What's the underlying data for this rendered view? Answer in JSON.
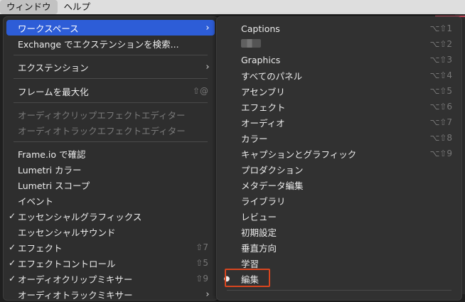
{
  "menubar": {
    "items": [
      {
        "label": "ウィンドウ",
        "active": true
      },
      {
        "label": "ヘルプ",
        "active": false
      }
    ]
  },
  "main_menu": {
    "items": [
      {
        "label": "ワークスペース",
        "checked": false,
        "shortcut": "",
        "submenu": true,
        "disabled": false,
        "highlight": true
      },
      {
        "label": "Exchange でエクステンションを検索...",
        "checked": false,
        "shortcut": "",
        "submenu": false,
        "disabled": false
      },
      {
        "label": "エクステンション",
        "checked": false,
        "shortcut": "",
        "submenu": true,
        "disabled": false
      },
      {
        "label": "フレームを最大化",
        "checked": false,
        "shortcut": "⇧@",
        "submenu": false,
        "disabled": false
      },
      {
        "label": "オーディオクリップエフェクトエディター",
        "checked": false,
        "shortcut": "",
        "submenu": false,
        "disabled": true
      },
      {
        "label": "オーディオトラックエフェクトエディター",
        "checked": false,
        "shortcut": "",
        "submenu": false,
        "disabled": true
      },
      {
        "label": "Frame.io で確認",
        "checked": false,
        "shortcut": "",
        "submenu": false,
        "disabled": false
      },
      {
        "label": "Lumetri カラー",
        "checked": false,
        "shortcut": "",
        "submenu": false,
        "disabled": false
      },
      {
        "label": "Lumetri スコープ",
        "checked": false,
        "shortcut": "",
        "submenu": false,
        "disabled": false
      },
      {
        "label": "イベント",
        "checked": false,
        "shortcut": "",
        "submenu": false,
        "disabled": false
      },
      {
        "label": "エッセンシャルグラフィックス",
        "checked": true,
        "shortcut": "",
        "submenu": false,
        "disabled": false
      },
      {
        "label": "エッセンシャルサウンド",
        "checked": false,
        "shortcut": "",
        "submenu": false,
        "disabled": false
      },
      {
        "label": "エフェクト",
        "checked": true,
        "shortcut": "⇧7",
        "submenu": false,
        "disabled": false
      },
      {
        "label": "エフェクトコントロール",
        "checked": true,
        "shortcut": "⇧5",
        "submenu": false,
        "disabled": false
      },
      {
        "label": "オーディオクリップミキサー",
        "checked": true,
        "shortcut": "⇧9",
        "submenu": false,
        "disabled": false
      },
      {
        "label": "オーディオトラックミキサー",
        "checked": false,
        "shortcut": "",
        "submenu": true,
        "disabled": false
      }
    ]
  },
  "workspace_submenu": {
    "items": [
      {
        "label": "Captions",
        "shortcut": "⌥⇧1",
        "bullet": false,
        "redacted": false
      },
      {
        "label": "",
        "shortcut": "⌥⇧2",
        "bullet": false,
        "redacted": true
      },
      {
        "label": "Graphics",
        "shortcut": "⌥⇧3",
        "bullet": false,
        "redacted": false
      },
      {
        "label": "すべてのパネル",
        "shortcut": "⌥⇧4",
        "bullet": false,
        "redacted": false
      },
      {
        "label": "アセンブリ",
        "shortcut": "⌥⇧5",
        "bullet": false,
        "redacted": false
      },
      {
        "label": "エフェクト",
        "shortcut": "⌥⇧6",
        "bullet": false,
        "redacted": false
      },
      {
        "label": "オーディオ",
        "shortcut": "⌥⇧7",
        "bullet": false,
        "redacted": false
      },
      {
        "label": "カラー",
        "shortcut": "⌥⇧8",
        "bullet": false,
        "redacted": false
      },
      {
        "label": "キャプションとグラフィック",
        "shortcut": "⌥⇧9",
        "bullet": false,
        "redacted": false
      },
      {
        "label": "プロダクション",
        "shortcut": "",
        "bullet": false,
        "redacted": false
      },
      {
        "label": "メタデータ編集",
        "shortcut": "",
        "bullet": false,
        "redacted": false
      },
      {
        "label": "ライブラリ",
        "shortcut": "",
        "bullet": false,
        "redacted": false
      },
      {
        "label": "レビュー",
        "shortcut": "",
        "bullet": false,
        "redacted": false
      },
      {
        "label": "初期設定",
        "shortcut": "",
        "bullet": false,
        "redacted": false
      },
      {
        "label": "垂直方向",
        "shortcut": "",
        "bullet": false,
        "redacted": false
      },
      {
        "label": "学習",
        "shortcut": "",
        "bullet": false,
        "redacted": false
      },
      {
        "label": "編集",
        "shortcut": "",
        "bullet": true,
        "redacted": false
      }
    ]
  },
  "colors": {
    "highlight": "#2d5dd7",
    "annotation": "#d9461f"
  }
}
